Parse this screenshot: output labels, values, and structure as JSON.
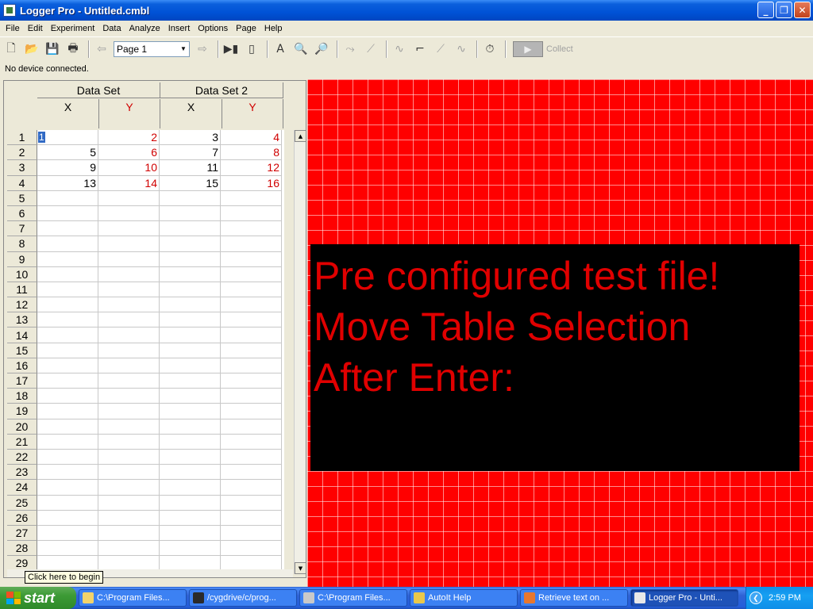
{
  "window": {
    "title": "Logger Pro - Untitled.cmbl"
  },
  "menubar": {
    "items": [
      "File",
      "Edit",
      "Experiment",
      "Data",
      "Analyze",
      "Insert",
      "Options",
      "Page",
      "Help"
    ]
  },
  "toolbar": {
    "page_select": "Page 1",
    "collect_label": "Collect",
    "buttons": [
      "new-file-icon",
      "open-folder-icon",
      "save-icon",
      "print-icon",
      "prev-page-icon",
      "next-page-icon",
      "data-browser-icon",
      "lab-setup-icon",
      "autoscale-icon",
      "zoom-in-icon",
      "zoom-out-icon",
      "examine-icon",
      "tangent-icon",
      "statistics-icon",
      "integral-icon",
      "linear-fit-icon",
      "curve-fit-icon",
      "stopwatch-icon",
      "collect-icon"
    ]
  },
  "status": {
    "text": "No device connected."
  },
  "table": {
    "sets": [
      {
        "name": "Data Set",
        "x_label": "X",
        "y_label": "Y"
      },
      {
        "name": "Data Set 2",
        "x_label": "X",
        "y_label": "Y"
      }
    ],
    "rows": [
      {
        "n": "1",
        "c": [
          "1",
          "2",
          "3",
          "4"
        ]
      },
      {
        "n": "2",
        "c": [
          "5",
          "6",
          "7",
          "8"
        ]
      },
      {
        "n": "3",
        "c": [
          "9",
          "10",
          "11",
          "12"
        ]
      },
      {
        "n": "4",
        "c": [
          "13",
          "14",
          "15",
          "16"
        ]
      },
      {
        "n": "5",
        "c": [
          "",
          "",
          "",
          ""
        ]
      },
      {
        "n": "6",
        "c": [
          "",
          "",
          "",
          ""
        ]
      },
      {
        "n": "7",
        "c": [
          "",
          "",
          "",
          ""
        ]
      },
      {
        "n": "8",
        "c": [
          "",
          "",
          "",
          ""
        ]
      },
      {
        "n": "9",
        "c": [
          "",
          "",
          "",
          ""
        ]
      },
      {
        "n": "10",
        "c": [
          "",
          "",
          "",
          ""
        ]
      },
      {
        "n": "11",
        "c": [
          "",
          "",
          "",
          ""
        ]
      },
      {
        "n": "12",
        "c": [
          "",
          "",
          "",
          ""
        ]
      },
      {
        "n": "13",
        "c": [
          "",
          "",
          "",
          ""
        ]
      },
      {
        "n": "14",
        "c": [
          "",
          "",
          "",
          ""
        ]
      },
      {
        "n": "15",
        "c": [
          "",
          "",
          "",
          ""
        ]
      },
      {
        "n": "16",
        "c": [
          "",
          "",
          "",
          ""
        ]
      },
      {
        "n": "17",
        "c": [
          "",
          "",
          "",
          ""
        ]
      },
      {
        "n": "18",
        "c": [
          "",
          "",
          "",
          ""
        ]
      },
      {
        "n": "19",
        "c": [
          "",
          "",
          "",
          ""
        ]
      },
      {
        "n": "20",
        "c": [
          "",
          "",
          "",
          ""
        ]
      },
      {
        "n": "21",
        "c": [
          "",
          "",
          "",
          ""
        ]
      },
      {
        "n": "22",
        "c": [
          "",
          "",
          "",
          ""
        ]
      },
      {
        "n": "23",
        "c": [
          "",
          "",
          "",
          ""
        ]
      },
      {
        "n": "24",
        "c": [
          "",
          "",
          "",
          ""
        ]
      },
      {
        "n": "25",
        "c": [
          "",
          "",
          "",
          ""
        ]
      },
      {
        "n": "26",
        "c": [
          "",
          "",
          "",
          ""
        ]
      },
      {
        "n": "27",
        "c": [
          "",
          "",
          "",
          ""
        ]
      },
      {
        "n": "28",
        "c": [
          "",
          "",
          "",
          ""
        ]
      },
      {
        "n": "29",
        "c": [
          "",
          "",
          "",
          ""
        ]
      }
    ]
  },
  "textbox": {
    "lines": [
      "Pre configured test file!",
      "Move Table Selection",
      "After Enter:"
    ]
  },
  "tooltip": {
    "text": "Click here to begin"
  },
  "taskbar": {
    "start_label": "start",
    "tasks": [
      {
        "label": "C:\\Program Files...",
        "icon": "folder-icon",
        "color": "#f3d36b"
      },
      {
        "label": "/cygdrive/c/prog...",
        "icon": "cygwin-icon",
        "color": "#2b2b2b"
      },
      {
        "label": "C:\\Program Files...",
        "icon": "autoit-icon",
        "color": "#c9c9c9"
      },
      {
        "label": "AutoIt Help",
        "icon": "help-icon",
        "color": "#e9c84a"
      },
      {
        "label": "Retrieve text on ...",
        "icon": "firefox-icon",
        "color": "#e8772e"
      },
      {
        "label": "Logger Pro - Unti...",
        "icon": "logger-pro-icon",
        "color": "#e8e8e8"
      }
    ],
    "clock": "2:59 PM"
  },
  "colors": {
    "accent_y": "#d00000",
    "page_bg": "#ff0000",
    "textbox_bg": "#000000",
    "textbox_fg": "#e00000"
  }
}
